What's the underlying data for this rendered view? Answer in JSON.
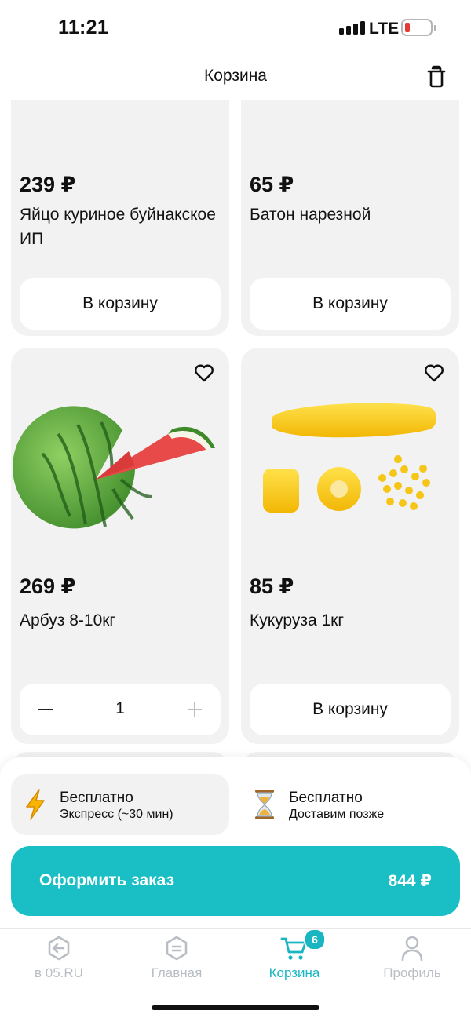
{
  "status_bar": {
    "time": "11:21",
    "network": "LTE"
  },
  "header": {
    "title": "Корзина",
    "clear_icon": "trash-icon"
  },
  "products": [
    {
      "price": "239 ₽",
      "name": "Яйцо куриное буйнакское ИП",
      "button": "В корзину",
      "image": "egg-image"
    },
    {
      "price": "65 ₽",
      "name": "Батон нарезной",
      "button": "В корзину",
      "image": "bread-image"
    },
    {
      "price": "269 ₽",
      "name": "Арбуз 8-10кг",
      "quantity": "1",
      "image": "watermelon-image",
      "favorite_icon": "heart-icon"
    },
    {
      "price": "85 ₽",
      "name": "Кукуруза 1кг",
      "button": "В корзину",
      "image": "corn-image",
      "favorite_icon": "heart-icon"
    }
  ],
  "delivery": {
    "express": {
      "title": "Бесплатно",
      "subtitle": "Экспресс (~30 мин)",
      "icon": "lightning-icon"
    },
    "later": {
      "title": "Бесплатно",
      "subtitle": "Доставим позже",
      "icon": "hourglass-icon"
    }
  },
  "checkout": {
    "label": "Оформить заказ",
    "total": "844 ₽",
    "color": "#1abfc6"
  },
  "nav": {
    "items": [
      {
        "label": "в 05.RU",
        "icon": "back-arrow-icon"
      },
      {
        "label": "Главная",
        "icon": "home-icon"
      },
      {
        "label": "Корзина",
        "icon": "cart-icon",
        "badge": "6",
        "active": true
      },
      {
        "label": "Профиль",
        "icon": "user-icon"
      }
    ],
    "active_color": "#19b6c2",
    "inactive_color": "#b8bec4"
  }
}
